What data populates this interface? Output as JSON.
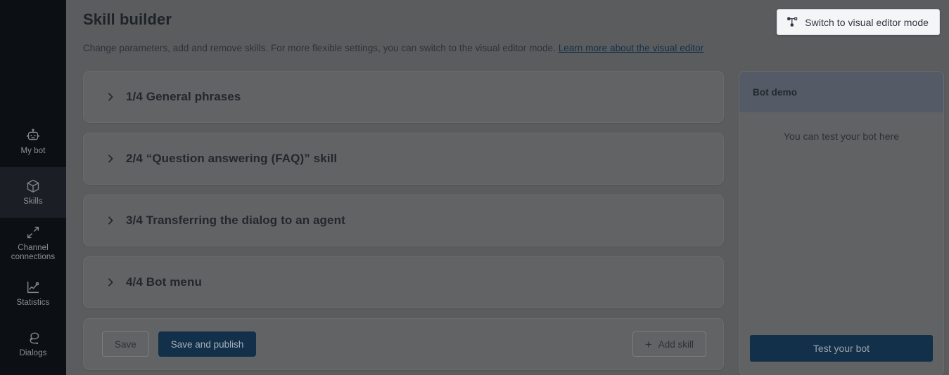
{
  "sidebar": {
    "items": [
      {
        "label": "My bot",
        "icon": "robot-icon",
        "active": false
      },
      {
        "label": "Skills",
        "icon": "cube-icon",
        "active": true
      },
      {
        "label": "Channel connections",
        "icon": "connections-icon",
        "active": false
      },
      {
        "label": "Statistics",
        "icon": "line-chart-icon",
        "active": false
      },
      {
        "label": "Dialogs",
        "icon": "chat-bubbles-icon",
        "active": false
      }
    ]
  },
  "header": {
    "title": "Skill builder",
    "subtitle": "Change parameters, add and remove skills. For more flexible settings, you can switch to the visual editor mode.",
    "link_text": "Learn more about the visual editor"
  },
  "switch_button": {
    "label": "Switch to visual editor mode",
    "icon": "flow-diagram-icon"
  },
  "skills": [
    {
      "title": "1/4 General phrases"
    },
    {
      "title": "2/4 “Question answering (FAQ)” skill"
    },
    {
      "title": "3/4 Transferring the dialog to an agent"
    },
    {
      "title": "4/4 Bot menu"
    }
  ],
  "actions": {
    "save_label": "Save",
    "save_publish_label": "Save and publish",
    "add_skill_label": "Add skill",
    "add_skill_icon": "plus-icon"
  },
  "bot_demo": {
    "panel_title": "Bot demo",
    "hint": "You can test your bot here",
    "test_button_label": "Test your bot"
  },
  "colors": {
    "sidebar_bg": "#0c0f13",
    "page_bg": "#5b5c5e",
    "card_bg": "#626365",
    "primary": "#123049",
    "demo_header_bg": "#555b66",
    "switch_btn_bg": "#f4f5f7"
  }
}
